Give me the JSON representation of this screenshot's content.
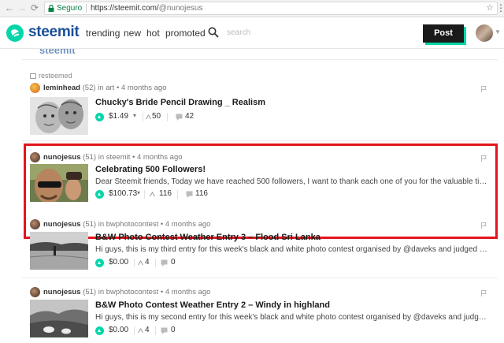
{
  "browser": {
    "back": "←",
    "forward": "→",
    "reload": "⟳",
    "secure_label": "Seguro",
    "url_base": "https://steemit.com/",
    "url_path": "@nunojesus",
    "star": "☆",
    "menu": "⋮"
  },
  "header": {
    "brand": "steemit",
    "nav": [
      "trending",
      "new",
      "hot",
      "promoted"
    ],
    "search_placeholder": "search",
    "post_label": "Post",
    "accent": "#06d6a9",
    "brand_color": "#1a5099"
  },
  "feed": {
    "partial_text": "steemit",
    "entries": [
      {
        "resteemed": "resteemed",
        "author": "leminhead",
        "rep": "(52)",
        "context": "in art • 4 months ago",
        "title": "Chucky's Bride Pencil Drawing _ Realism",
        "excerpt": "",
        "payout": "$1.49",
        "has_caret": true,
        "votes": "50",
        "comments": "42"
      },
      {
        "resteemed": "",
        "author": "nunojesus",
        "rep": "(51)",
        "context": "in steemit • 4 months ago",
        "title": "Celebrating 500 Followers!",
        "excerpt": "Dear Steemit friends, Today we have reached 500 followers, I want to thank each one of you for the valuable time you…",
        "payout": "$100.73",
        "has_caret": true,
        "votes": "116",
        "comments": "116",
        "highlighted": true
      },
      {
        "resteemed": "",
        "author": "nunojesus",
        "rep": "(51)",
        "context": "in bwphotocontest • 4 months ago",
        "title": "B&W Photo Contest Weather Entry 3 – Flood Sri Lanka",
        "excerpt": "Hi guys, this is my third entry for this week's black and white photo contest organised by @daveks and judged by…",
        "payout": "$0.00",
        "has_caret": false,
        "votes": "4",
        "comments": "0"
      },
      {
        "resteemed": "",
        "author": "nunojesus",
        "rep": "(51)",
        "context": "in bwphotocontest • 4 months ago",
        "title": "B&W Photo Contest Weather Entry 2 – Windy in highland",
        "excerpt": "Hi guys, this is my second entry for this week's black and white photo contest organised by @daveks and judged by…",
        "payout": "$0.00",
        "has_caret": false,
        "votes": "4",
        "comments": "0"
      }
    ],
    "highlight_color": "#e2161e"
  }
}
